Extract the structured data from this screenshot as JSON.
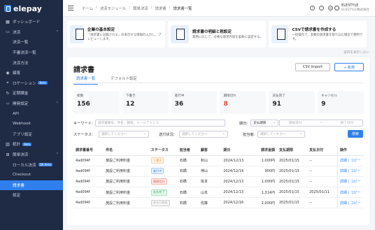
{
  "brand": {
    "name": "elepay"
  },
  "sidebar": {
    "items": [
      {
        "label": "ダッシュボード",
        "icon": "dashboard-icon",
        "type": "top"
      },
      {
        "label": "決済",
        "icon": "wallet-icon",
        "type": "group",
        "chevron": "⌃"
      },
      {
        "label": "決済一覧",
        "type": "sub"
      },
      {
        "label": "不審決済一覧",
        "type": "sub"
      },
      {
        "label": "決済方法",
        "type": "sub"
      },
      {
        "label": "顧客",
        "icon": "user-icon",
        "type": "top"
      },
      {
        "label": "ロケーション",
        "icon": "location-icon",
        "type": "top",
        "badge": "Beta"
      },
      {
        "label": "定期課金",
        "icon": "repeat-icon",
        "type": "top"
      },
      {
        "label": "開発設定",
        "icon": "code-icon",
        "type": "group",
        "chevron": "⌃"
      },
      {
        "label": "API",
        "type": "sub"
      },
      {
        "label": "Webhook",
        "type": "sub"
      },
      {
        "label": "アプリ設定",
        "type": "sub"
      },
      {
        "label": "統計",
        "icon": "chart-icon",
        "type": "top",
        "badge": "Beta"
      },
      {
        "label": "簡単決済",
        "icon": "cart-icon",
        "type": "group",
        "chevron": "⌃"
      },
      {
        "label": "ローカル決済",
        "type": "sub",
        "badge": "QR Beta"
      },
      {
        "label": "Checkout",
        "type": "sub"
      },
      {
        "label": "請求書",
        "type": "sub",
        "active": true
      },
      {
        "label": "設定",
        "type": "sub"
      }
    ]
  },
  "breadcrumb": [
    "ホーム",
    "決済モジュール",
    "簡単決済",
    "請求書",
    "請求書一覧"
  ],
  "user": {
    "name": "ELESTYLE",
    "company": "ELESTYLE株式会社"
  },
  "guides": [
    {
      "title": "企業の基本設定",
      "desc": "「請求書に記載される」の表示する情報の入力し、プレビューします。"
    },
    {
      "title": "請求書の明細と税設定",
      "desc": "業務に応じて、必要な請求内容を柔軟に設定する。"
    },
    {
      "title": "CSVで請求書を作成する",
      "desc": "一括操作で、多数の請求書を取り込む場合で便利です。"
    }
  ],
  "hide_link": "案内を表示しない",
  "page": {
    "title": "請求書",
    "csv_button": "CSV Import",
    "new_button": "+ 新規"
  },
  "tabs": [
    {
      "label": "請求書一覧",
      "active": true
    },
    {
      "label": "デフォルト設定",
      "active": false
    }
  ],
  "stats": [
    {
      "label": "総数",
      "value": "156"
    },
    {
      "label": "下書き",
      "value": "12"
    },
    {
      "label": "進行中",
      "value": "36"
    },
    {
      "label": "期限切れ",
      "value": "8",
      "red": true
    },
    {
      "label": "支払完了",
      "value": "91"
    },
    {
      "label": "キャンセル",
      "value": "9"
    }
  ],
  "filters": {
    "keyword_label": "キーワード:",
    "keyword_placeholder": "請求書番号、件名、顧客、メールアドレス",
    "date_label": "期日:",
    "date_type": "支払期限",
    "start_placeholder": "開始日付",
    "end_placeholder": "終了日付",
    "status_label": "ステータス:",
    "status_placeholder": "選択してください",
    "send_label": "送付状況:",
    "send_placeholder": "選択してください",
    "owner_label": "担当者:",
    "owner_placeholder": "選択してください",
    "search_button": "検索",
    "date_sep": "~"
  },
  "table": {
    "columns": [
      "請求書番号",
      "件名",
      "ステータス",
      "担当者",
      "顧客",
      "期日",
      "請求金額",
      "支払期限",
      "支払日付",
      "操作"
    ],
    "rows": [
      {
        "id": "4ad094f",
        "subject": "施設ご利用料金",
        "status": "下書き",
        "status_class": "b-draft",
        "owner": "石橋",
        "customer": "秋山",
        "date": "2024/12/13",
        "amount": "1,000円",
        "due": "2025/01/15",
        "paid": "--",
        "ops": "詳細 | コピー"
      },
      {
        "id": "4ad094f",
        "subject": "施設ご利用料金",
        "status": "進行中",
        "status_class": "b-sent",
        "owner": "石橋",
        "customer": "神山",
        "date": "2024/12/14",
        "amount": "900円",
        "due": "2025/01/15",
        "paid": "--",
        "ops": "詳細 | コピー"
      },
      {
        "id": "4ad094f",
        "subject": "施設ご利用料金",
        "status": "期限切れ",
        "status_class": "b-over",
        "owner": "石橋",
        "customer": "坂本",
        "date": "2024/12/13",
        "amount": "1,000円",
        "due": "2025/01/15",
        "paid": "--",
        "ops": "詳細 | コピー"
      },
      {
        "id": "4ad094f",
        "subject": "施設ご利用料金",
        "status": "支払完了",
        "status_class": "b-paid",
        "owner": "石橋",
        "customer": "山本",
        "date": "2024/12/13",
        "amount": "1,314円",
        "due": "2025/01/15",
        "paid": "2025/01/11",
        "ops": "詳細 | コピー"
      },
      {
        "id": "4ad094f",
        "subject": "施設ご利用料金",
        "status": "キャンセル",
        "status_class": "b-cancel",
        "owner": "石橋",
        "customer": "佐藤",
        "date": "2024/12/16",
        "amount": "2,000円",
        "due": "2025/01/15",
        "paid": "--",
        "ops": "詳細 | コピー"
      }
    ]
  }
}
